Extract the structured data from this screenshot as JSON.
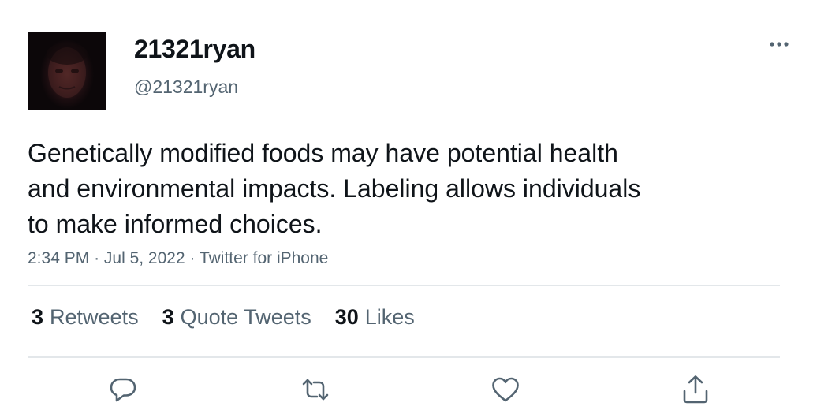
{
  "author": {
    "display_name": "21321ryan",
    "handle": "@21321ryan"
  },
  "tweet": {
    "text_lines": [
      "Genetically modified foods may have potential health",
      "and environmental impacts. Labeling allows individuals",
      "to make informed choices."
    ],
    "time": "2:34 PM",
    "date": "Jul 5, 2022",
    "source": "Twitter for iPhone",
    "separator": "·"
  },
  "stats": {
    "retweets": {
      "count": "3",
      "label": "Retweets"
    },
    "quotes": {
      "count": "3",
      "label": "Quote Tweets"
    },
    "likes": {
      "count": "30",
      "label": "Likes"
    }
  },
  "actions": {
    "reply": "reply-icon",
    "retweet": "retweet-icon",
    "like": "heart-icon",
    "share": "share-icon"
  },
  "colors": {
    "text": "#0f1419",
    "secondary": "#536471",
    "divider": "#e3e7ea"
  }
}
